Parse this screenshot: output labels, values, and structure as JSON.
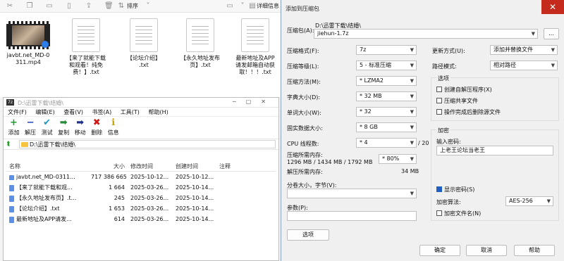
{
  "explorer_toolbar": {
    "sort_label": "排序",
    "view_label": "",
    "details_label": "详细信息"
  },
  "files": [
    {
      "name_line1": "javbt.net_MD-0",
      "name_line2": "311.mp4",
      "name_line3": ""
    },
    {
      "name_line1": "【来了就能下载",
      "name_line2": "和观看！纯免",
      "name_line3": "费！】.txt"
    },
    {
      "name_line1": "【论坛介绍】",
      "name_line2": ".txt",
      "name_line3": ""
    },
    {
      "name_line1": "【永久地址发布",
      "name_line2": "页】.txt",
      "name_line3": ""
    },
    {
      "name_line1": "最新地址及APP",
      "name_line2": "请发邮箱自动获",
      "name_line3": "取！！！.txt"
    }
  ],
  "zip": {
    "app_icon": "7z",
    "path": "D:\\迅雷下载\\结婚\\",
    "menu": [
      "文件(F)",
      "编辑(E)",
      "查看(V)",
      "书签(A)",
      "工具(T)",
      "帮助(H)"
    ],
    "tools": [
      {
        "label": "添加",
        "icon": "+",
        "color": "#1e9e2e"
      },
      {
        "label": "解压",
        "icon": "−",
        "color": "#2244bb"
      },
      {
        "label": "测试",
        "icon": "✔",
        "color": "#1b9bbf"
      },
      {
        "label": "复制",
        "icon": "➡",
        "color": "#2a8a3a"
      },
      {
        "label": "移动",
        "icon": "➡",
        "color": "#22338a"
      },
      {
        "label": "删除",
        "icon": "✖",
        "color": "#d01818"
      },
      {
        "label": "信息",
        "icon": "ℹ",
        "color": "#c9a200"
      }
    ],
    "address": "D:\\迅雷下载\\结婚\\",
    "columns": [
      "名称",
      "大小",
      "修改时间",
      "创建时间",
      "注释"
    ],
    "rows": [
      {
        "name": "javbt.net_MD-0311...",
        "size": "717 386 665",
        "modified": "2025-10-12...",
        "created": "2025-10-12...",
        "comment": ""
      },
      {
        "name": "【来了就能下载和观...",
        "size": "1 664",
        "modified": "2025-03-26...",
        "created": "2025-10-14...",
        "comment": ""
      },
      {
        "name": "【永久地址发布页】.t...",
        "size": "245",
        "modified": "2025-03-26...",
        "created": "2025-10-14...",
        "comment": ""
      },
      {
        "name": "【论坛介绍】.txt",
        "size": "1 653",
        "modified": "2025-03-26...",
        "created": "2025-10-14...",
        "comment": ""
      },
      {
        "name": "最新地址及APP请发...",
        "size": "614",
        "modified": "2025-03-26...",
        "created": "2025-10-14...",
        "comment": ""
      }
    ]
  },
  "dialog": {
    "title": "添加到压缩包",
    "archive_label": "压缩包(A):",
    "archive_dir": "D:\\迅雷下载\\结婚\\",
    "archive_name": "jiehun-1.7z",
    "browse": "...",
    "format_label": "压缩格式(F):",
    "format_value": "7z",
    "level_label": "压缩等级(L):",
    "level_value": "5 - 标准压缩",
    "method_label": "压缩方法(M):",
    "method_value": "* LZMA2",
    "dict_label": "字典大小(D):",
    "dict_value": "* 32 MB",
    "word_label": "单词大小(W):",
    "word_value": "* 32",
    "solid_label": "固实数据大小:",
    "solid_value": "* 8 GB",
    "cpu_label": "CPU 线程数:",
    "cpu_value": "* 4",
    "cpu_total": "/ 20",
    "mem_label": "压缩所需内存:",
    "mem_value": "1296 MB / 1434 MB / 1792 MB",
    "mem_pct": "* 80%",
    "unmem_label": "解压所需内存:",
    "unmem_value": "34 MB",
    "split_label": "分卷大小，字节(V):",
    "params_label": "参数(P):",
    "options_btn": "选项",
    "update_label": "更新方式(U):",
    "update_value": "添加并替换文件",
    "pathmode_label": "路径模式:",
    "pathmode_value": "相对路径",
    "options_group": "选项",
    "opt_sfx": "创建自解压程序(X)",
    "opt_shared": "压缩共享文件",
    "opt_delete": "操作完成后删除源文件",
    "enc_group": "加密",
    "pwd_label": "输入密码:",
    "pwd_value": "上老王论坛当老王",
    "show_pwd": "显示密码(S)",
    "enc_method_label": "加密算法:",
    "enc_method_value": "AES-256",
    "enc_names": "加密文件名(N)",
    "ok": "确定",
    "cancel": "取消",
    "help": "帮助"
  }
}
